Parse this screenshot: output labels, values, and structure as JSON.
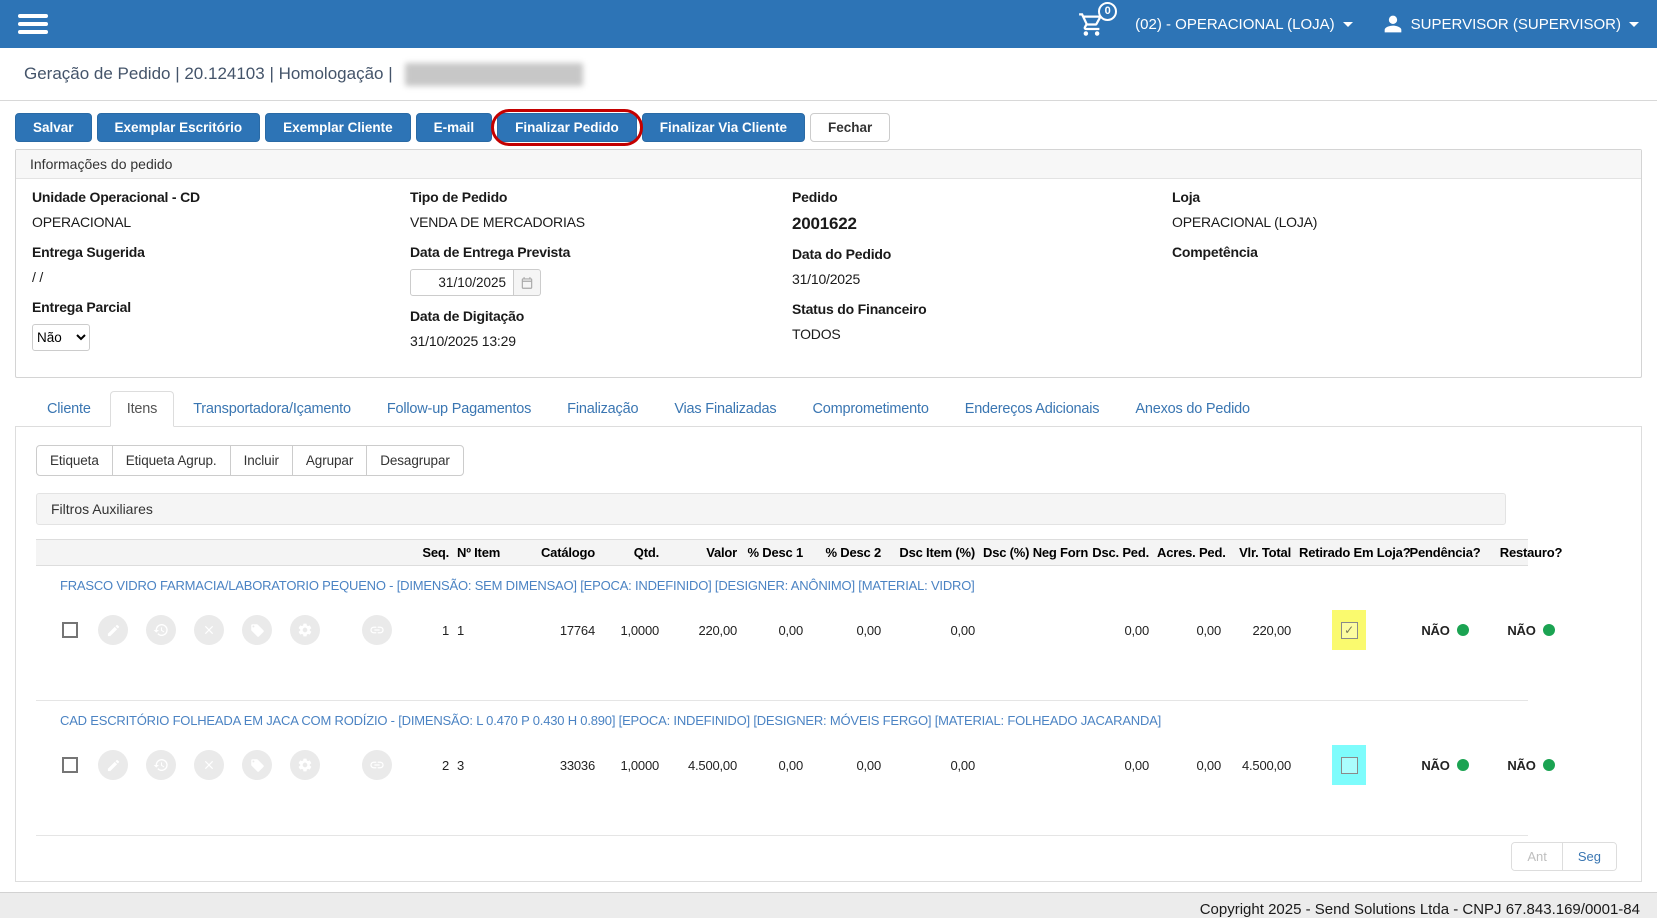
{
  "colors": {
    "topbar_blue": "#2d74b6",
    "link_blue": "#3a76b2",
    "description_blue": "#4b83c3",
    "highlight_yellow": "#fafa6e",
    "highlight_cyan": "#7efcfc",
    "status_green": "#1ba352",
    "annotation_red": "#c40000"
  },
  "topbar": {
    "cart_count": "0",
    "store_menu": "(02) - OPERACIONAL (LOJA)",
    "user_menu": "SUPERVISOR (SUPERVISOR)"
  },
  "breadcrumb": "Geração de Pedido | 20.124103 | Homologação |",
  "toolbar": {
    "salvar": "Salvar",
    "exemplar_escritorio": "Exemplar Escritório",
    "exemplar_cliente": "Exemplar Cliente",
    "email": "E-mail",
    "finalizar_pedido": "Finalizar Pedido",
    "finalizar_via_cliente": "Finalizar Via Cliente",
    "fechar": "Fechar"
  },
  "order_info": {
    "title": "Informações do pedido",
    "unidade_label": "Unidade Operacional - CD",
    "unidade_value": "OPERACIONAL",
    "entrega_sugerida_label": "Entrega Sugerida",
    "entrega_sugerida_value": "/ /",
    "entrega_parcial_label": "Entrega Parcial",
    "entrega_parcial_value": "Não",
    "tipo_label": "Tipo de Pedido",
    "tipo_value": "VENDA DE MERCADORIAS",
    "data_entrega_label": "Data de Entrega Prevista",
    "data_entrega_value": "31/10/2025",
    "data_digitacao_label": "Data de Digitação",
    "data_digitacao_value": "31/10/2025 13:29",
    "pedido_label": "Pedido",
    "pedido_value": "2001622",
    "data_pedido_label": "Data do Pedido",
    "data_pedido_value": "31/10/2025",
    "status_financeiro_label": "Status do Financeiro",
    "status_financeiro_value": "TODOS",
    "loja_label": "Loja",
    "loja_value": "OPERACIONAL (LOJA)",
    "competencia_label": "Competência",
    "competencia_value": ""
  },
  "tabs": [
    {
      "label": "Cliente"
    },
    {
      "label": "Itens"
    },
    {
      "label": "Transportadora/Içamento"
    },
    {
      "label": "Follow-up Pagamentos"
    },
    {
      "label": "Finalização"
    },
    {
      "label": "Vias Finalizadas"
    },
    {
      "label": "Comprometimento"
    },
    {
      "label": "Endereços Adicionais"
    },
    {
      "label": "Anexos do Pedido"
    }
  ],
  "items_toolbar": {
    "etiqueta": "Etiqueta",
    "etiqueta_agrup": "Etiqueta Agrup.",
    "incluir": "Incluir",
    "agrupar": "Agrupar",
    "desagrupar": "Desagrupar"
  },
  "filters_title": "Filtros Auxiliares",
  "table": {
    "headers": [
      "Seq.",
      "Nº Item",
      "Catálogo",
      "Qtd.",
      "Valor",
      "% Desc 1",
      "% Desc 2",
      "Dsc Item (%)",
      "Dsc (%) Neg Forn",
      "Dsc. Ped.",
      "Acres. Ped.",
      "Vlr. Total",
      "Retirado Em Loja?",
      "Pendência?",
      "Restauro?"
    ],
    "rows": [
      {
        "description": "FRASCO VIDRO FARMACIA/LABORATORIO PEQUENO - [DIMENSÃO: SEM DIMENSAO] [EPOCA: INDEFINIDO] [DESIGNER: ANÔNIMO] [MATERIAL: VIDRO]",
        "seq": "1",
        "n_item": "1",
        "catalogo": "17764",
        "qtd": "1,0000",
        "valor": "220,00",
        "desc1": "0,00",
        "desc2": "0,00",
        "dsc_item": "0,00",
        "dsc_neg_forn": "",
        "dsc_ped": "0,00",
        "acres_ped": "0,00",
        "vlr_total": "220,00",
        "retirado_check": "✓",
        "retirado_highlight": "#fafa6e",
        "pendencia": "NÃO",
        "restauro": "NÃO"
      },
      {
        "description": "CAD ESCRITÓRIO FOLHEADA EM JACA COM RODÍZIO - [DIMENSÃO: L 0.470 P 0.430 H 0.890] [EPOCA: INDEFINIDO] [DESIGNER: MÓVEIS FERGO] [MATERIAL: FOLHEADO JACARANDA]",
        "seq": "2",
        "n_item": "3",
        "catalogo": "33036",
        "qtd": "1,0000",
        "valor": "4.500,00",
        "desc1": "0,00",
        "desc2": "0,00",
        "dsc_item": "0,00",
        "dsc_neg_forn": "",
        "dsc_ped": "0,00",
        "acres_ped": "0,00",
        "vlr_total": "4.500,00",
        "retirado_check": "",
        "retirado_highlight": "#7efcfc",
        "pendencia": "NÃO",
        "restauro": "NÃO"
      }
    ]
  },
  "pagination": {
    "prev": "Ant",
    "next": "Seg"
  },
  "footer": "Copyright 2025 - Send Solutions Ltda - CNPJ 67.843.169/0001-84"
}
